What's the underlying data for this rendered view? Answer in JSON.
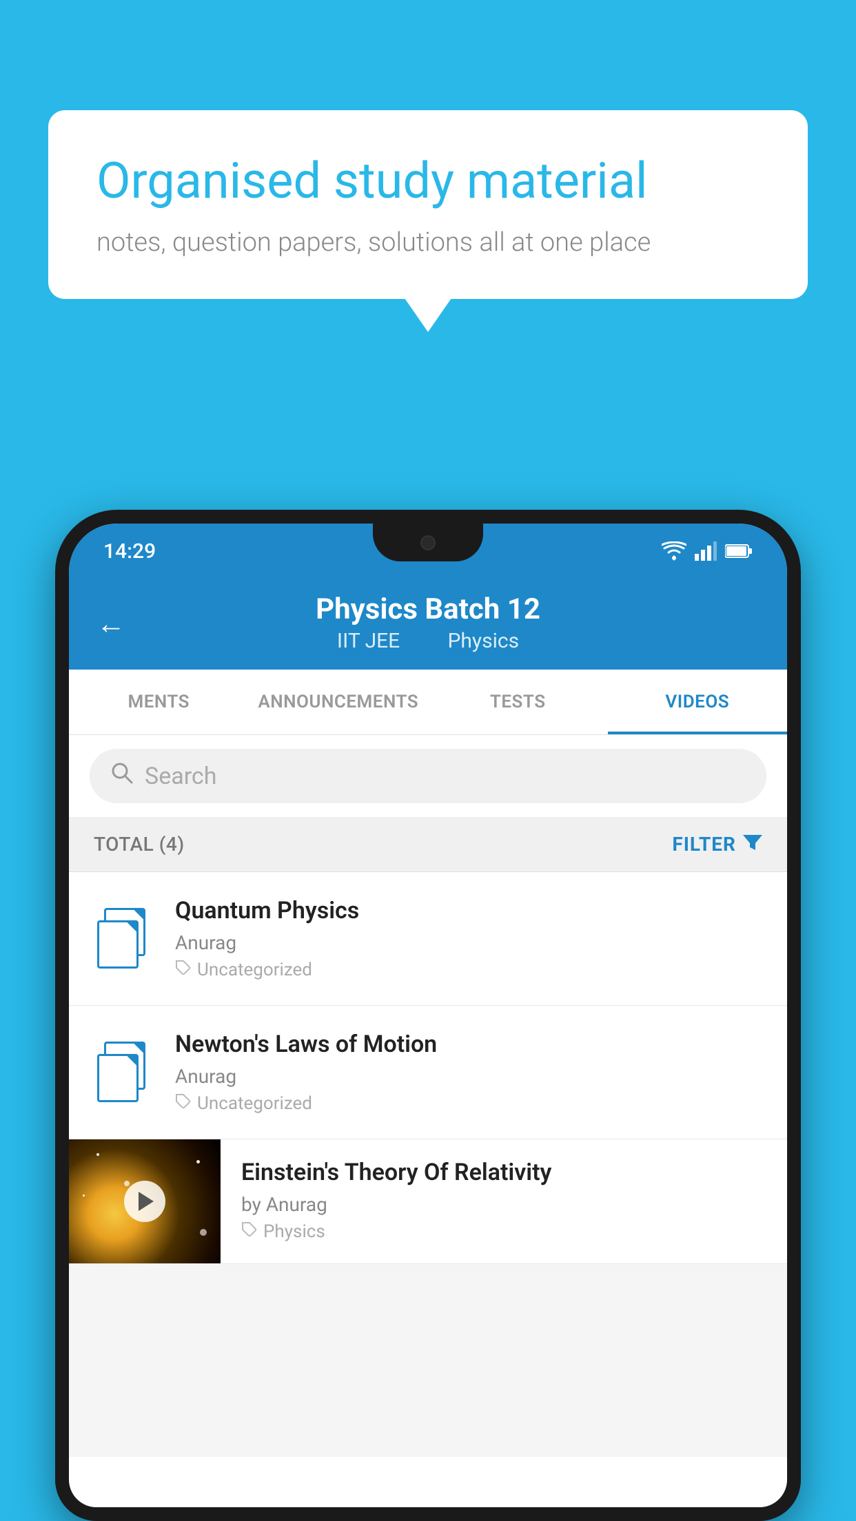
{
  "background": {
    "color": "#29b8e8"
  },
  "speech_bubble": {
    "title": "Organised study material",
    "subtitle": "notes, question papers, solutions all at one place"
  },
  "phone": {
    "status_bar": {
      "time": "14:29",
      "wifi": "▾",
      "signal": "▲",
      "battery": "▮"
    },
    "header": {
      "back_label": "←",
      "title": "Physics Batch 12",
      "subtitle_course": "IIT JEE",
      "subtitle_subject": "Physics"
    },
    "tabs": [
      {
        "label": "MENTS",
        "active": false
      },
      {
        "label": "ANNOUNCEMENTS",
        "active": false
      },
      {
        "label": "TESTS",
        "active": false
      },
      {
        "label": "VIDEOS",
        "active": true
      }
    ],
    "search": {
      "placeholder": "Search"
    },
    "filter": {
      "total_label": "TOTAL (4)",
      "filter_label": "FILTER"
    },
    "videos": [
      {
        "id": 1,
        "title": "Quantum Physics",
        "author": "Anurag",
        "tag": "Uncategorized",
        "has_thumbnail": false
      },
      {
        "id": 2,
        "title": "Newton's Laws of Motion",
        "author": "Anurag",
        "tag": "Uncategorized",
        "has_thumbnail": false
      },
      {
        "id": 3,
        "title": "Einstein's Theory Of Relativity",
        "author": "by Anurag",
        "tag": "Physics",
        "has_thumbnail": true
      }
    ]
  }
}
